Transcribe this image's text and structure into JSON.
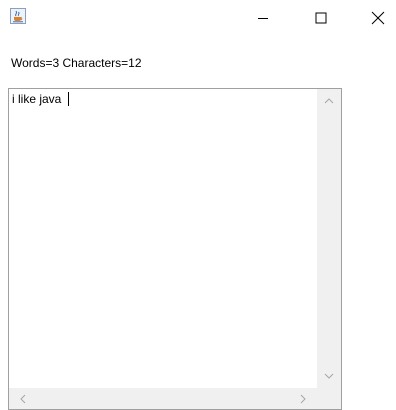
{
  "window": {
    "icon": "java-cup-icon",
    "controls": {
      "minimize_icon": "minimize-icon",
      "maximize_icon": "maximize-icon",
      "close_icon": "close-icon"
    }
  },
  "counter": {
    "text": "Words=3 Characters=12"
  },
  "editor": {
    "value": "i like java "
  },
  "scrollbars": {
    "vertical": {
      "up_icon": "chevron-up-icon",
      "down_icon": "chevron-down-icon"
    },
    "horizontal": {
      "left_icon": "chevron-left-icon",
      "right_icon": "chevron-right-icon"
    }
  }
}
